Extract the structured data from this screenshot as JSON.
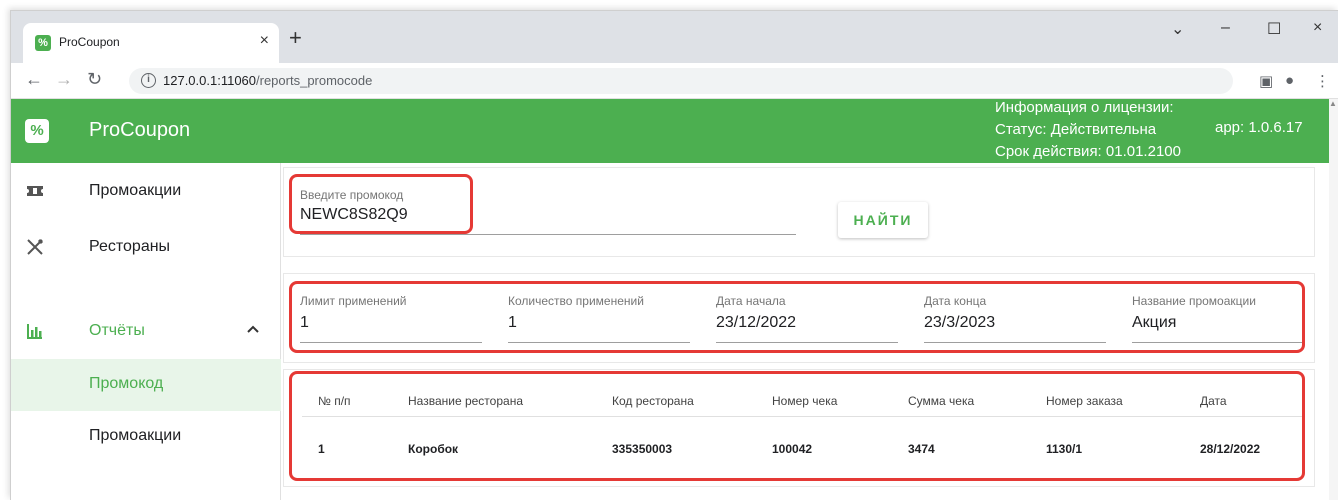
{
  "browser": {
    "tab_title": "ProCoupon",
    "tab_close": "×",
    "new_tab": "+",
    "url_host": "127.0.0.1:11060",
    "url_path": "/reports_promocode",
    "win_min": "–",
    "win_max": "☐",
    "win_close": "×",
    "win_dropdown": "⌄"
  },
  "app": {
    "logo": "%",
    "title": "ProCoupon",
    "license_line1": "Информация о лицензии:",
    "license_line2": "Статус: Действительна",
    "license_line3": "Срок действия: 01.01.2100",
    "version": "app: 1.0.6.17",
    "accent_color": "#4caf50",
    "highlight_color": "#e53935"
  },
  "sidebar": {
    "items": [
      {
        "label": "Промоакции",
        "icon": "ticket-icon"
      },
      {
        "label": "Рестораны",
        "icon": "utensils-icon"
      },
      {
        "label": "Отчёты",
        "icon": "bar-chart-icon"
      }
    ],
    "reports_sub": [
      {
        "label": "Промокод"
      },
      {
        "label": "Промоакции"
      }
    ]
  },
  "search": {
    "label": "Введите промокод",
    "value": "NEWC8S82Q9",
    "button": "НАЙТИ"
  },
  "details": {
    "limit_label": "Лимит применений",
    "limit_value": "1",
    "count_label": "Количество применений",
    "count_value": "1",
    "start_label": "Дата начала",
    "start_value": "23/12/2022",
    "end_label": "Дата конца",
    "end_value": "23/3/2023",
    "promo_label": "Название промоакции",
    "promo_value": "Акция"
  },
  "table": {
    "headers": [
      "№ п/п",
      "Название ресторана",
      "Код ресторана",
      "Номер чека",
      "Сумма чека",
      "Номер заказа",
      "Дата"
    ],
    "rows": [
      [
        "1",
        "Коробок",
        "335350003",
        "100042",
        "3474",
        "1130/1",
        "28/12/2022"
      ]
    ]
  }
}
